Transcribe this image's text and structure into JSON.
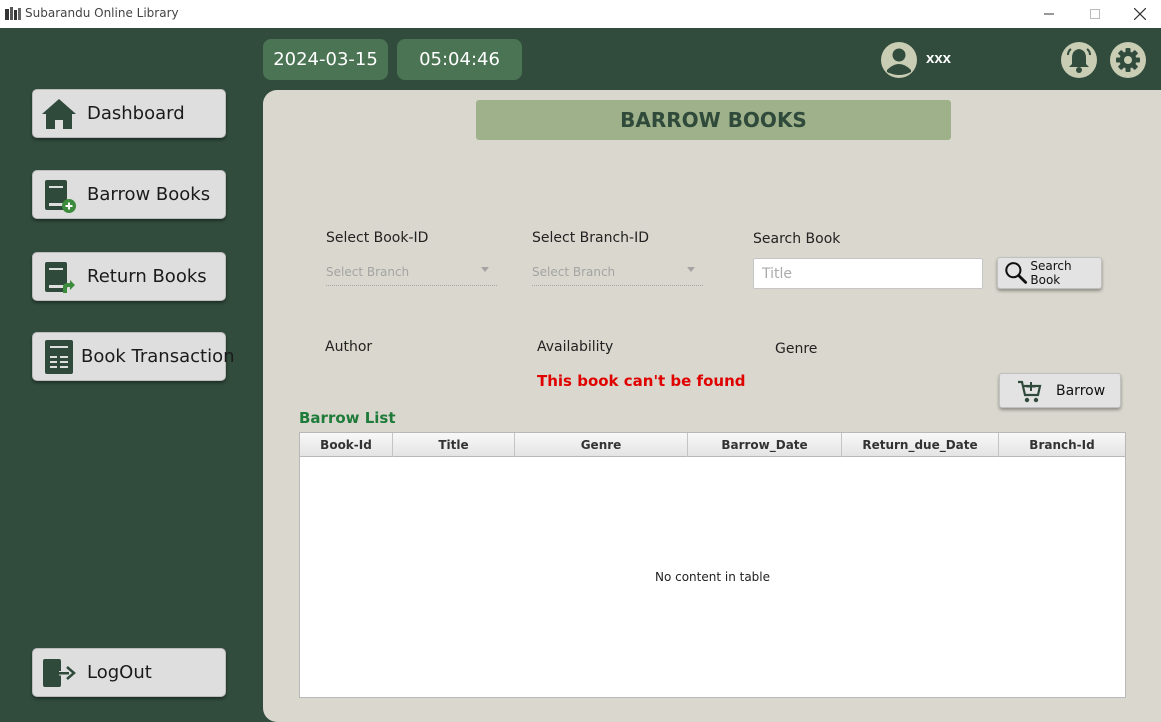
{
  "window": {
    "title": "Subarandu Online Library",
    "controls": {
      "minimize": "minimize",
      "maximize": "maximize",
      "close": "close"
    }
  },
  "topbar": {
    "date": "2024-03-15",
    "time": "05:04:46",
    "user_name": "xxx",
    "icons": [
      "user-icon",
      "bell-icon",
      "gear-icon"
    ]
  },
  "sidebar": {
    "items": [
      {
        "label": "Dashboard",
        "icon": "home-icon"
      },
      {
        "label": "Barrow Books",
        "icon": "book-add-icon"
      },
      {
        "label": "Return Books",
        "icon": "book-return-icon"
      },
      {
        "label": "Book Transaction",
        "icon": "ledger-icon"
      }
    ],
    "logout": {
      "label": "LogOut",
      "icon": "logout-icon"
    }
  },
  "main": {
    "heading": "BARROW BOOKS",
    "fields": {
      "book_id_label": "Select Book-ID",
      "book_id_placeholder": "Select Branch",
      "branch_id_label": "Select Branch-ID",
      "branch_id_placeholder": "Select Branch",
      "search_label": "Search Book",
      "search_placeholder": "Title",
      "search_button": "Search Book",
      "author_label": "Author",
      "availability_label": "Availability",
      "genre_label": "Genre"
    },
    "error_message": "This book can't be found",
    "barrow_button": "Barrow",
    "list_title": "Barrow List",
    "table": {
      "columns": [
        "Book-Id",
        "Title",
        "Genre",
        "Barrow_Date",
        "Return_due_Date",
        "Branch-Id"
      ],
      "rows": [],
      "empty_text": "No content in table"
    }
  },
  "colors": {
    "background": "#314c3d",
    "panel": "#dad8ce",
    "heading_bg": "#9eb18a",
    "pill": "#4a7453",
    "error": "#e00000",
    "list_title": "#1e7b3a"
  }
}
